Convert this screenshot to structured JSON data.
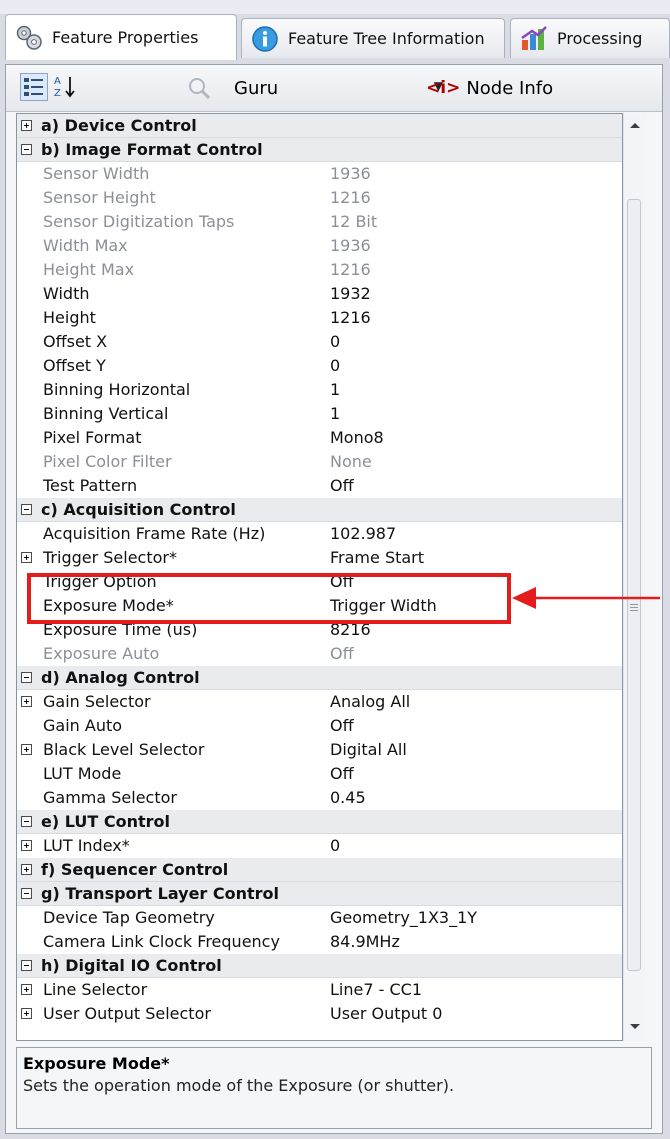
{
  "tabs": [
    {
      "label": "Feature Properties",
      "icon": "gears-icon"
    },
    {
      "label": "Feature Tree Information",
      "icon": "info-icon"
    },
    {
      "label": "Processing",
      "icon": "chart-icon"
    }
  ],
  "toolbar": {
    "visibility": "Guru",
    "node_info": "Node Info",
    "node_info_mark": "<i>"
  },
  "rows": [
    {
      "type": "cat",
      "exp": "plus",
      "name": "a) Device Control"
    },
    {
      "type": "cat",
      "exp": "minus",
      "name": "b) Image Format Control"
    },
    {
      "type": "item",
      "dim": true,
      "name": "Sensor Width",
      "value": "1936"
    },
    {
      "type": "item",
      "dim": true,
      "name": "Sensor Height",
      "value": "1216"
    },
    {
      "type": "item",
      "dim": true,
      "name": "Sensor Digitization Taps",
      "value": "12 Bit"
    },
    {
      "type": "item",
      "dim": true,
      "name": "Width Max",
      "value": "1936"
    },
    {
      "type": "item",
      "dim": true,
      "name": "Height Max",
      "value": "1216"
    },
    {
      "type": "item",
      "dim": false,
      "name": "Width",
      "value": "1932"
    },
    {
      "type": "item",
      "dim": false,
      "name": "Height",
      "value": "1216"
    },
    {
      "type": "item",
      "dim": false,
      "name": "Offset X",
      "value": "0"
    },
    {
      "type": "item",
      "dim": false,
      "name": "Offset Y",
      "value": "0"
    },
    {
      "type": "item",
      "dim": false,
      "name": "Binning Horizontal",
      "value": "1"
    },
    {
      "type": "item",
      "dim": false,
      "name": "Binning Vertical",
      "value": "1"
    },
    {
      "type": "item",
      "dim": false,
      "name": "Pixel Format",
      "value": "Mono8"
    },
    {
      "type": "item",
      "dim": true,
      "name": "Pixel Color Filter",
      "value": "None"
    },
    {
      "type": "item",
      "dim": false,
      "name": "Test Pattern",
      "value": "Off"
    },
    {
      "type": "cat",
      "exp": "minus",
      "name": "c) Acquisition Control"
    },
    {
      "type": "item",
      "dim": false,
      "name": "Acquisition Frame Rate (Hz)",
      "value": "102.987"
    },
    {
      "type": "item",
      "dim": false,
      "exp": "plus",
      "name": "Trigger Selector*",
      "value": "Frame Start"
    },
    {
      "type": "item",
      "dim": false,
      "name": "Trigger Option",
      "value": "Off"
    },
    {
      "type": "item",
      "dim": false,
      "name": "Exposure Mode*",
      "value": "Trigger Width"
    },
    {
      "type": "item",
      "dim": false,
      "name": "Exposure Time (us)",
      "value": "8216"
    },
    {
      "type": "item",
      "dim": true,
      "name": "Exposure Auto",
      "value": "Off"
    },
    {
      "type": "cat",
      "exp": "minus",
      "name": "d) Analog Control"
    },
    {
      "type": "item",
      "dim": false,
      "exp": "plus",
      "name": "Gain Selector",
      "value": "Analog All"
    },
    {
      "type": "item",
      "dim": false,
      "name": "Gain Auto",
      "value": "Off"
    },
    {
      "type": "item",
      "dim": false,
      "exp": "plus",
      "name": "Black Level Selector",
      "value": "Digital All"
    },
    {
      "type": "item",
      "dim": false,
      "name": "LUT Mode",
      "value": "Off"
    },
    {
      "type": "item",
      "dim": false,
      "name": "Gamma Selector",
      "value": "0.45"
    },
    {
      "type": "cat",
      "exp": "minus",
      "name": "e) LUT Control"
    },
    {
      "type": "item",
      "dim": false,
      "exp": "plus",
      "name": "LUT Index*",
      "value": "0"
    },
    {
      "type": "cat",
      "exp": "plus",
      "name": "f) Sequencer Control"
    },
    {
      "type": "cat",
      "exp": "minus",
      "name": "g) Transport Layer Control"
    },
    {
      "type": "item",
      "dim": false,
      "name": "Device Tap Geometry",
      "value": "Geometry_1X3_1Y"
    },
    {
      "type": "item",
      "dim": false,
      "name": "Camera Link Clock Frequency",
      "value": "84.9MHz"
    },
    {
      "type": "cat",
      "exp": "minus",
      "name": "h) Digital IO Control"
    },
    {
      "type": "item",
      "dim": false,
      "exp": "plus",
      "name": "Line Selector",
      "value": "Line7 - CC1"
    },
    {
      "type": "item",
      "dim": false,
      "exp": "plus",
      "name": "User Output Selector",
      "value": "User Output 0"
    }
  ],
  "description": {
    "title": "Exposure Mode*",
    "text": "Sets the operation mode of the Exposure (or shutter)."
  },
  "colors": {
    "highlight": "#e41c1c",
    "dim_text": "#8b8f96",
    "category_bg": "#e9ebee"
  }
}
